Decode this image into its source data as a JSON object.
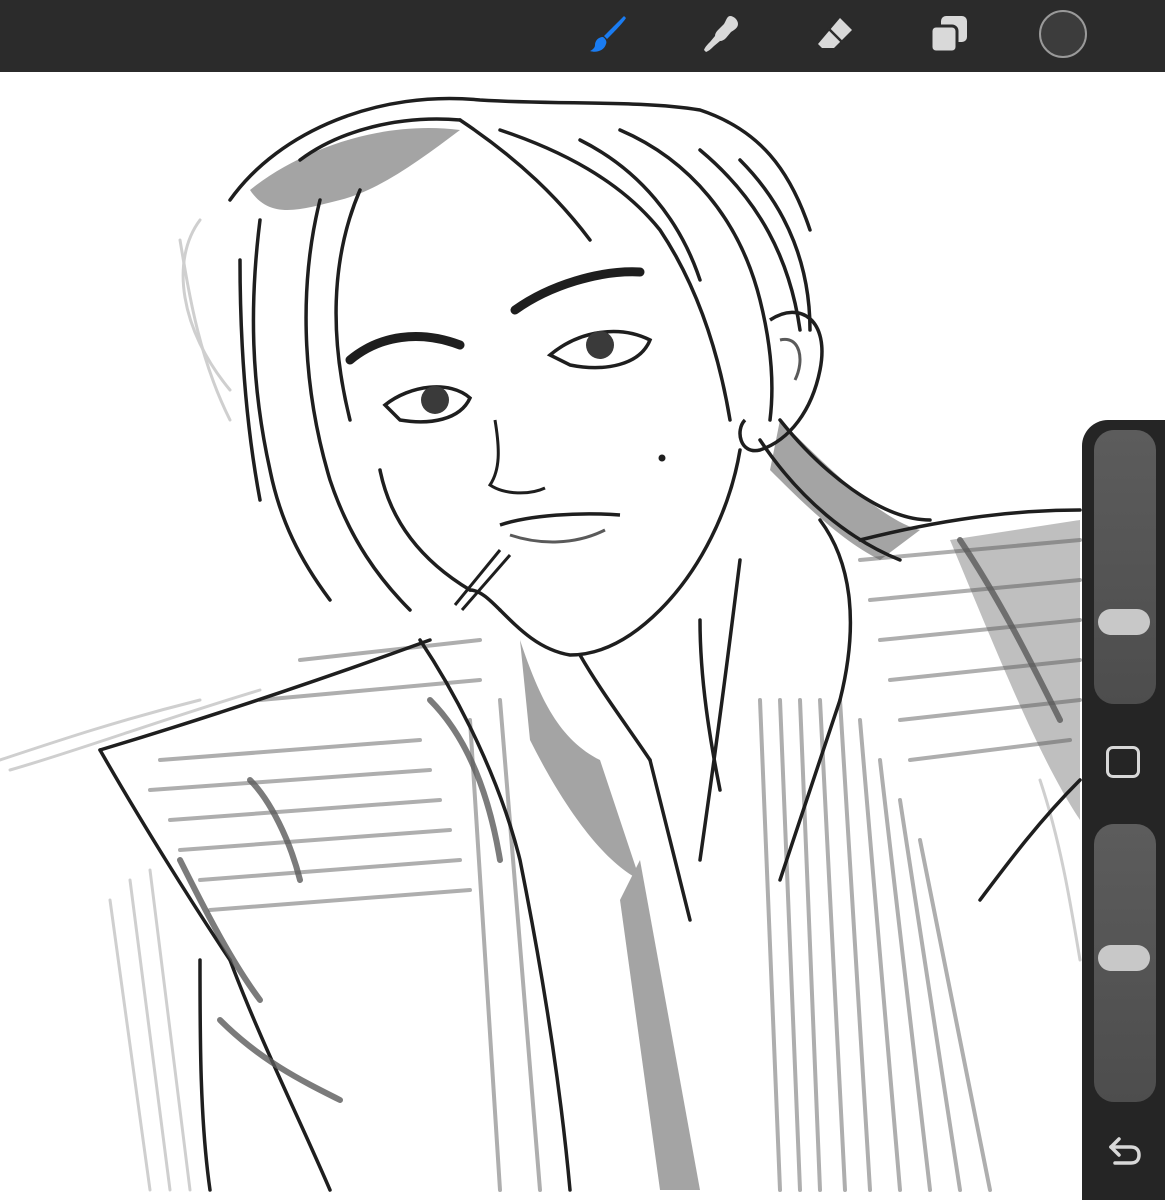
{
  "colors": {
    "toolbar_bg": "#2b2b2b",
    "sidebar_bg": "#252525",
    "active_tool": "#1a7cf2",
    "inactive_tool": "#d9d9d9",
    "current_color": "#3c3c3c",
    "slider_track": "#555555",
    "slider_thumb": "#c8c8c8"
  },
  "toolbar": {
    "tools": [
      {
        "id": "brush",
        "icon": "paint-brush-icon",
        "active": true
      },
      {
        "id": "smudge",
        "icon": "smudge-finger-icon",
        "active": false
      },
      {
        "id": "eraser",
        "icon": "eraser-icon",
        "active": false
      },
      {
        "id": "layers",
        "icon": "layers-icon",
        "active": false
      }
    ],
    "color_swatch": {
      "icon": "color-swatch",
      "color": "#3c3c3c"
    }
  },
  "sidebar": {
    "brush_size": {
      "icon": "slider",
      "level": 0.72
    },
    "opacity": {
      "icon": "slider",
      "level": 0.52
    },
    "modify_button": {
      "icon": "square-outline-icon"
    },
    "undo_button": {
      "icon": "undo-arrow-icon"
    }
  },
  "canvas": {
    "content": "pencil-sketch",
    "palette": [
      "#1e1e1e",
      "#5a5a5a",
      "#9a9a9a",
      "#cfcfcf"
    ]
  }
}
